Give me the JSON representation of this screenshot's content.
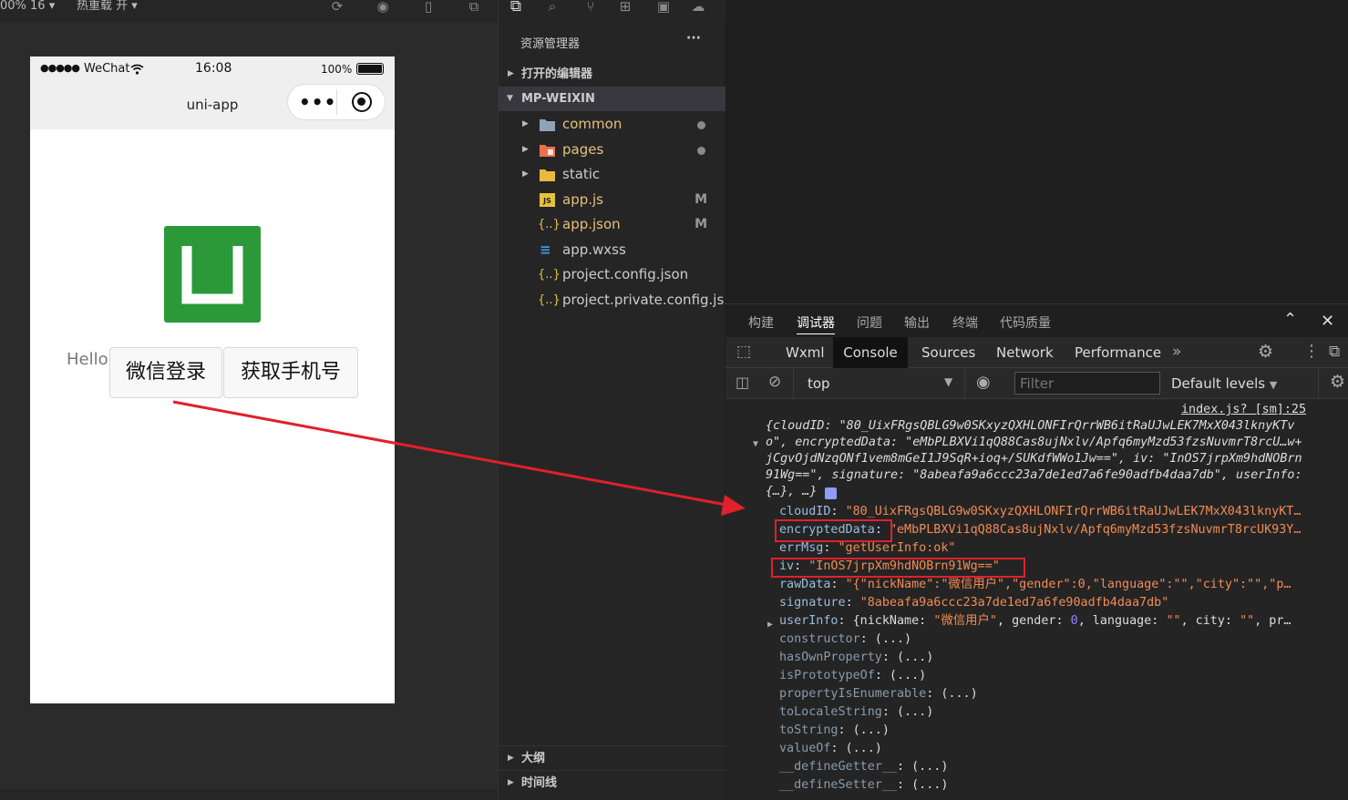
{
  "sim_toolbar": {
    "zoom": "00% 16",
    "hot_reload": "热重载 开"
  },
  "phone": {
    "status": {
      "signal": "●●●●●",
      "carrier": "WeChat",
      "time": "16:08",
      "battery": "100%"
    },
    "nav_title": "uni-app",
    "hello": "Hello",
    "buttons": [
      "微信登录",
      "获取手机号"
    ]
  },
  "explorer": {
    "title": "资源管理器",
    "more": "···",
    "open_editors": "打开的编辑器",
    "project": "MP-WEIXIN",
    "files": [
      {
        "name": "common",
        "type": "folder"
      },
      {
        "name": "pages",
        "type": "folder"
      },
      {
        "name": "static",
        "type": "folder"
      },
      {
        "name": "app.js",
        "type": "js",
        "badge": "M"
      },
      {
        "name": "app.json",
        "type": "json",
        "badge": "M"
      },
      {
        "name": "app.wxss",
        "type": "css"
      },
      {
        "name": "project.config.json",
        "type": "json"
      },
      {
        "name": "project.private.config.js...",
        "type": "json"
      }
    ],
    "outline": "大纲",
    "timeline": "时间线"
  },
  "devtools": {
    "top_tabs": [
      "构建",
      "调试器",
      "问题",
      "输出",
      "终端",
      "代码质量"
    ],
    "active_top": "调试器",
    "panel_tabs": [
      "Wxml",
      "Console",
      "Sources",
      "Network",
      "Performance"
    ],
    "active_panel": "Console",
    "context": "top",
    "filter_placeholder": "Filter",
    "levels": "Default levels",
    "source_link": "index.js? [sm]:25"
  },
  "console_lines": {
    "l1": "{cloudID: \"80_UixFRgsQBLG9w0SKxyzQXHLONFIrQrrWB6itRaUJwLEK7MxX043lknyKTv",
    "l2a": "o\", encryptedData: \"eMbPLBXVi1qQ88Cas8ujNxlv/Apfq6myMzd53fzsNuvmrT8rcU…w+",
    "l3": "jCgvOjdNzqONf1vem8mGeI1J9SqR+ioq+/SUKdfWWo1Jw==\", iv: \"InOS7jrpXm9hdNOBrn",
    "l4": "91Wg==\", signature: \"8abeafa9a6ccc23a7de1ed7a6fe90adfb4daa7db\", userInfo:",
    "l5": "{…}, …}",
    "cloudID_val": "\"80_UixFRgsQBLG9w0SKxyzQXHLONFIrQrrWB6itRaUJwLEK7MxX043lknyKT…",
    "enc_val": "\"eMbPLBXVi1qQ88Cas8ujNxlv/Apfq6myMzd53fzsNuvmrT8rcUK93Y…",
    "errMsg_val": "\"getUserInfo:ok\"",
    "iv_val": "\"InOS7jrpXm9hdNOBrn91Wg==\"",
    "raw_val": "\"{\"nickName\":\"微信用户\",\"gender\":0,\"language\":\"\",\"city\":\"\",\"p…",
    "sig_val": "\"8abeafa9a6ccc23a7de1ed7a6fe90adfb4daa7db\"",
    "ui_pre": "{nickName: ",
    "ui_nick": "\"微信用户\"",
    "ui_mid": ", gender: ",
    "ui_gender": "0",
    "ui_mid2": ", language: ",
    "ui_lang": "\"\"",
    "ui_mid3": ", city: ",
    "ui_city": "\"\"",
    "ui_end": ", pr…"
  },
  "proto_methods": [
    "constructor",
    "hasOwnProperty",
    "isPrototypeOf",
    "propertyIsEnumerable",
    "toLocaleString",
    "toString",
    "valueOf",
    "__defineGetter__",
    "__defineSetter__"
  ],
  "colors": {
    "accent_red": "#e0202b",
    "uni_green": "#2b9939",
    "string": "#f28b54",
    "key": "#9bbbdc"
  }
}
